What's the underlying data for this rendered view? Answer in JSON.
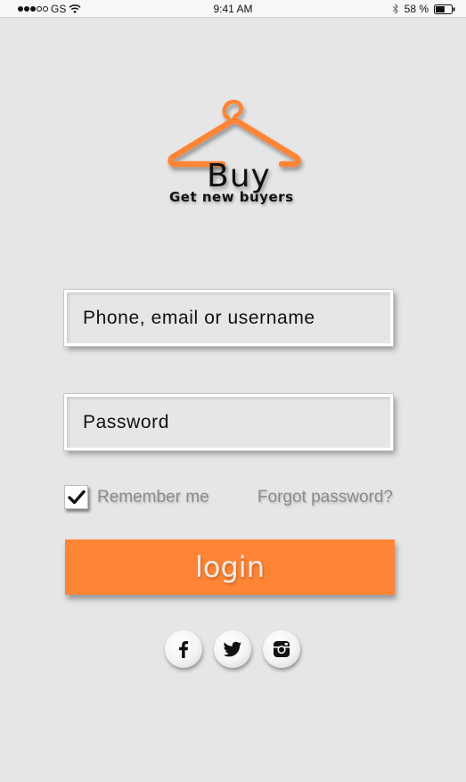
{
  "status_bar": {
    "carrier": "GS",
    "time": "9:41 AM",
    "battery_percent": "58 %",
    "battery_level": 0.58,
    "signal_bars_filled": 3,
    "signal_bars_total": 5
  },
  "brand": {
    "name": "Buy",
    "tagline": "Get new buyers",
    "accent_color": "#ff8536"
  },
  "login_form": {
    "username_placeholder": "Phone, email or username",
    "username_value": "",
    "password_placeholder": "Password",
    "password_value": "",
    "remember_label": "Remember me",
    "remember_checked": true,
    "forgot_label": "Forgot password?",
    "login_label": "login"
  },
  "social": [
    {
      "name": "facebook",
      "icon": "facebook-icon"
    },
    {
      "name": "twitter",
      "icon": "twitter-icon"
    },
    {
      "name": "instagram",
      "icon": "instagram-icon"
    }
  ]
}
